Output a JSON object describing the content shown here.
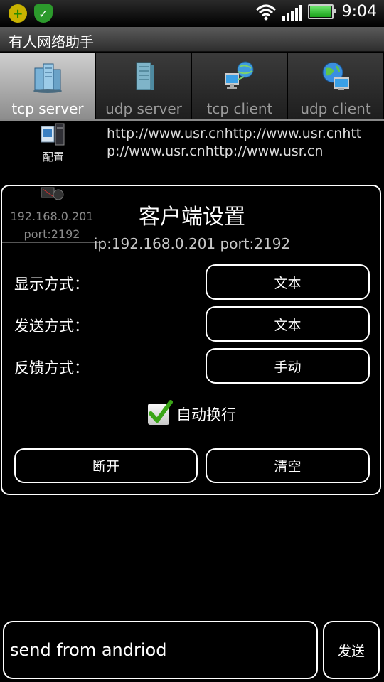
{
  "statusbar": {
    "icons": [
      "plus-notification-icon",
      "shield-icon",
      "wifi-icon",
      "signal-icon",
      "battery-icon"
    ],
    "time": "9:04"
  },
  "titlebar": {
    "title": "有人网络助手"
  },
  "tabs": [
    {
      "label": "tcp server",
      "icon": "server-icon",
      "active": true
    },
    {
      "label": "udp server",
      "icon": "server-tower-icon",
      "active": false
    },
    {
      "label": "tcp client",
      "icon": "network-client-icon",
      "active": false
    },
    {
      "label": "udp client",
      "icon": "globe-network-icon",
      "active": false
    }
  ],
  "config": {
    "label": "配置",
    "text": "http://www.usr.cnhttp://www.usr.cnhttp://www.usr.cnhttp://www.usr.cn"
  },
  "client_item": {
    "ip": "192.168.0.201",
    "port": "port:2192"
  },
  "dialog": {
    "title": "客户端设置",
    "subtitle": "ip:192.168.0.201  port:2192",
    "rows": [
      {
        "label": "显示方式：",
        "value": "文本"
      },
      {
        "label": "发送方式：",
        "value": "文本"
      },
      {
        "label": "反馈方式：",
        "value": "手动"
      }
    ],
    "checkbox": {
      "label": "自动换行",
      "checked": true
    },
    "disconnect_label": "断开",
    "clear_label": "清空"
  },
  "bottom": {
    "input_value": "send from andriod",
    "send_label": "发送"
  },
  "colors": {
    "background": "#000000",
    "tab_active": "#b0b0b0",
    "check": "#3aa517"
  }
}
